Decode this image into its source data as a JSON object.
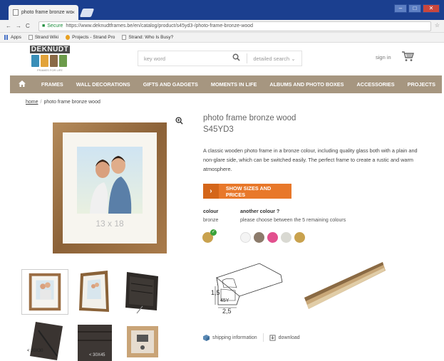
{
  "browser": {
    "tab_title": "photo frame bronze wo",
    "tab_close": "×",
    "secure_label": "Secure",
    "url": "https://www.deknudtframes.be/en/catalog/product/s45yd3-/photo-frame-bronze-wood",
    "bookmarks": [
      "Apps",
      "Strand Wiki",
      "Projects - Strand Pro",
      "Strand: Who Is Busy?"
    ]
  },
  "header": {
    "logo_text": "DEKNUDT",
    "logo_tagline": "FRAMES FOR LIFE",
    "logo_colors": [
      "#3a8fb8",
      "#e2a33a",
      "#8a6a46",
      "#6c9b4b"
    ],
    "search_placeholder": "key word",
    "detailed_search": "detailed search",
    "sign_in": "sign in"
  },
  "nav": {
    "items": [
      "FRAMES",
      "WALL DECORATIONS",
      "GIFTS AND GADGETS",
      "MOMENTS IN LIFE",
      "ALBUMS AND PHOTO BOXES",
      "ACCESSORIES",
      "PROJECTS"
    ]
  },
  "breadcrumb": {
    "home": "home",
    "current": "photo frame bronze wood"
  },
  "product": {
    "title": "photo frame bronze wood",
    "code": "S45YD3",
    "description": "A classic wooden photo frame in a bronze colour, including quality glass both with a plain and non-glare side, which can be switched easily. The perfect frame to create a rustic and warm atmosphere.",
    "size_label": "13 x 18",
    "show_sizes_label": "SHOW SIZES AND PRICES",
    "colour_label": "colour",
    "colour_value": "bronze",
    "colour_current_hex": "#c9a24e",
    "another_colour_label": "another colour ?",
    "another_colour_text": "please choose between the 5 remaining colours",
    "other_colours": [
      "#f4f4f4",
      "#8c7b6b",
      "#e2508e",
      "#d9d9d2",
      "#c9a24e"
    ],
    "dimension_width": "2,5",
    "dimension_height": "1,5",
    "profile_code": "45Y"
  },
  "thumbnails": {
    "labels": [
      "< 30X30",
      "< 30X45"
    ]
  },
  "actions": {
    "shipping": "shipping information",
    "download": "download"
  },
  "colors": {
    "nav_bg": "#a69680",
    "accent_orange": "#e8782a",
    "browser_tab_bar": "#1b3f8f"
  }
}
